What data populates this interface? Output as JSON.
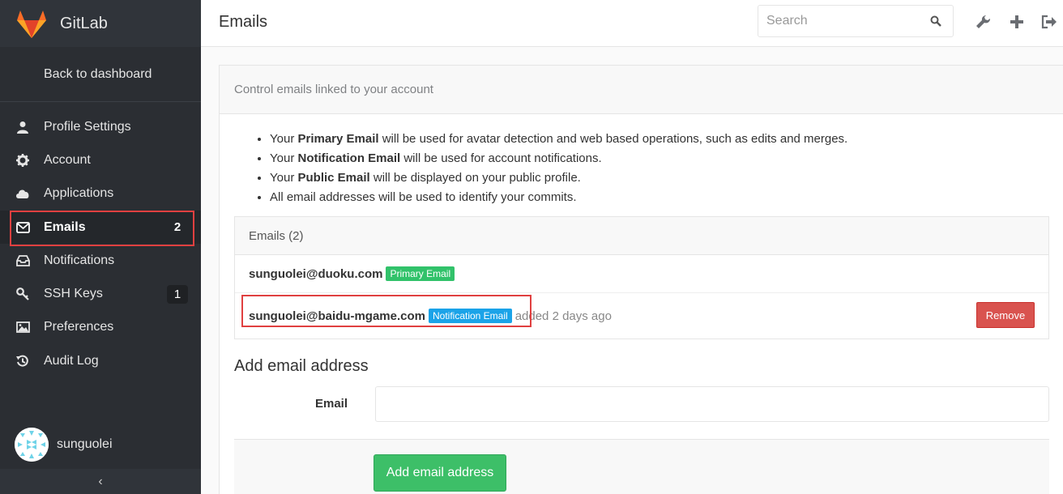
{
  "brand": {
    "name": "GitLab",
    "accent": "#fc6d26"
  },
  "sidebar": {
    "back_label": "Back to dashboard",
    "items": [
      {
        "label": "Profile Settings",
        "icon": "user-icon",
        "count": ""
      },
      {
        "label": "Account",
        "icon": "gear-icon",
        "count": ""
      },
      {
        "label": "Applications",
        "icon": "cloud-icon",
        "count": ""
      },
      {
        "label": "Emails",
        "icon": "envelope-icon",
        "count": "2"
      },
      {
        "label": "Notifications",
        "icon": "inbox-icon",
        "count": ""
      },
      {
        "label": "SSH Keys",
        "icon": "key-icon",
        "count": "1"
      },
      {
        "label": "Preferences",
        "icon": "image-icon",
        "count": ""
      },
      {
        "label": "Audit Log",
        "icon": "history-icon",
        "count": ""
      }
    ],
    "active": "Emails",
    "user": {
      "name": "sunguolei"
    },
    "collapse_glyph": "‹"
  },
  "header": {
    "title": "Emails",
    "search_placeholder": "Search"
  },
  "main": {
    "panel_heading": "Control emails linked to your account",
    "bullets": [
      {
        "pre": "Your ",
        "strong": "Primary Email",
        "post": " will be used for avatar detection and web based operations, such as edits and merges."
      },
      {
        "pre": "Your ",
        "strong": "Notification Email",
        "post": " will be used for account notifications."
      },
      {
        "pre": "Your ",
        "strong": "Public Email",
        "post": " will be displayed on your public profile."
      },
      {
        "pre": "All email addresses will be used to identify your commits.",
        "strong": "",
        "post": ""
      }
    ],
    "emails_heading": "Emails (2)",
    "emails": [
      {
        "address": "sunguolei@duoku.com",
        "badge": "Primary Email",
        "badge_color": "#31c26a",
        "meta": ""
      },
      {
        "address": "sunguolei@baidu-mgame.com",
        "badge": "Notification Email",
        "badge_color": "#1aa3e8",
        "meta": "added 2 days ago",
        "remove_label": "Remove"
      }
    ],
    "add_title": "Add email address",
    "email_field_label": "Email",
    "email_field_value": "",
    "add_button_label": "Add email address"
  }
}
